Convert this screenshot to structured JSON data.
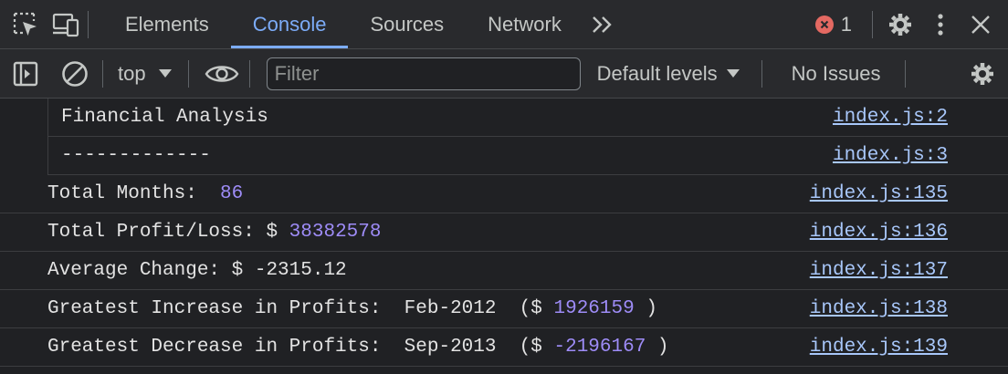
{
  "tabbar": {
    "tabs": [
      "Elements",
      "Console",
      "Sources",
      "Network"
    ],
    "active_tab": "Console",
    "error_count": "1"
  },
  "toolbar": {
    "context": "top",
    "filter_placeholder": "Filter",
    "levels": "Default levels",
    "issues": "No Issues"
  },
  "console": {
    "rows": [
      {
        "text": "Financial Analysis",
        "source": "index.js:2"
      },
      {
        "text": "-------------",
        "source": "index.js:3"
      },
      {
        "label": "Total Months:  ",
        "value": "86",
        "source": "index.js:135"
      },
      {
        "label": "Total Profit/Loss: $ ",
        "value": "38382578",
        "source": "index.js:136"
      },
      {
        "text": "Average Change: $ -2315.12",
        "source": "index.js:137"
      },
      {
        "label": "Greatest Increase in Profits:  Feb-2012  ($ ",
        "value": "1926159",
        "suffix": " )",
        "source": "index.js:138"
      },
      {
        "label": "Greatest Decrease in Profits:  Sep-2013  ($ ",
        "value": "-2196167",
        "suffix": " )",
        "source": "index.js:139"
      }
    ]
  },
  "colors": {
    "background": "#202124",
    "toolbar": "#292a2d",
    "accent": "#7cacf8",
    "number": "#9e8cf7",
    "link": "#a8c7fa",
    "error": "#e46962"
  }
}
